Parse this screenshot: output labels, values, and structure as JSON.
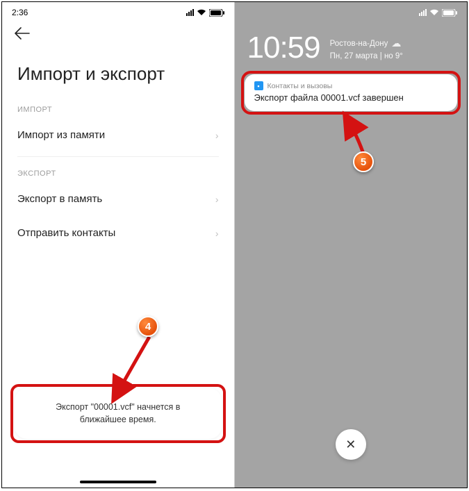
{
  "left": {
    "status_time": "2:36",
    "title": "Импорт и экспорт",
    "section_import": "ИМПОРТ",
    "row_import": "Импорт из памяти",
    "section_export": "ЭКСПОРТ",
    "row_export1": "Экспорт в память",
    "row_export2": "Отправить контакты",
    "toast": "Экспорт \"00001.vcf\" начнется в ближайшее время."
  },
  "right": {
    "lock_time": "10:59",
    "lock_city": "Ростов-на-Дону",
    "lock_date": "Пн, 27 марта | но 9°",
    "notif_app": "Контакты и вызовы",
    "notif_text": "Экспорт файла 00001.vcf завершен",
    "dismiss": "✕"
  },
  "callouts": {
    "b4": "4",
    "b5": "5"
  }
}
